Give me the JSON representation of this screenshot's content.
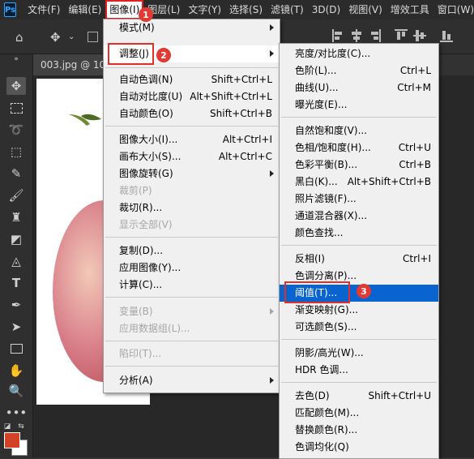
{
  "app": {
    "logo": "Ps"
  },
  "menubar": [
    "文件(F)",
    "编辑(E)",
    "图像(I)",
    "图层(L)",
    "文字(Y)",
    "选择(S)",
    "滤镜(T)",
    "3D(D)",
    "视图(V)",
    "增效工具",
    "窗口(W)"
  ],
  "options_bar": {
    "label": "控件"
  },
  "document": {
    "tab": "003.jpg @ 10"
  },
  "image_menu": [
    {
      "label": "模式(M)",
      "shortcut": "",
      "submenu": true,
      "disabled": false
    },
    {
      "label": "调整(J)",
      "shortcut": "",
      "submenu": true,
      "disabled": false
    },
    {
      "label": "自动色调(N)",
      "shortcut": "Shift+Ctrl+L",
      "submenu": false,
      "disabled": false
    },
    {
      "label": "自动对比度(U)",
      "shortcut": "Alt+Shift+Ctrl+L",
      "submenu": false,
      "disabled": false
    },
    {
      "label": "自动颜色(O)",
      "shortcut": "Shift+Ctrl+B",
      "submenu": false,
      "disabled": false
    },
    {
      "label": "图像大小(I)...",
      "shortcut": "Alt+Ctrl+I",
      "submenu": false,
      "disabled": false
    },
    {
      "label": "画布大小(S)...",
      "shortcut": "Alt+Ctrl+C",
      "submenu": false,
      "disabled": false
    },
    {
      "label": "图像旋转(G)",
      "shortcut": "",
      "submenu": true,
      "disabled": false
    },
    {
      "label": "裁剪(P)",
      "shortcut": "",
      "submenu": false,
      "disabled": true
    },
    {
      "label": "裁切(R)...",
      "shortcut": "",
      "submenu": false,
      "disabled": false
    },
    {
      "label": "显示全部(V)",
      "shortcut": "",
      "submenu": false,
      "disabled": true
    },
    {
      "label": "复制(D)...",
      "shortcut": "",
      "submenu": false,
      "disabled": false
    },
    {
      "label": "应用图像(Y)...",
      "shortcut": "",
      "submenu": false,
      "disabled": false
    },
    {
      "label": "计算(C)...",
      "shortcut": "",
      "submenu": false,
      "disabled": false
    },
    {
      "label": "变量(B)",
      "shortcut": "",
      "submenu": true,
      "disabled": true
    },
    {
      "label": "应用数据组(L)...",
      "shortcut": "",
      "submenu": false,
      "disabled": true
    },
    {
      "label": "陷印(T)...",
      "shortcut": "",
      "submenu": false,
      "disabled": true
    },
    {
      "label": "分析(A)",
      "shortcut": "",
      "submenu": true,
      "disabled": false
    }
  ],
  "adjust_menu": [
    {
      "label": "亮度/对比度(C)...",
      "shortcut": ""
    },
    {
      "label": "色阶(L)...",
      "shortcut": "Ctrl+L"
    },
    {
      "label": "曲线(U)...",
      "shortcut": "Ctrl+M"
    },
    {
      "label": "曝光度(E)...",
      "shortcut": ""
    },
    {
      "label": "自然饱和度(V)...",
      "shortcut": ""
    },
    {
      "label": "色相/饱和度(H)...",
      "shortcut": "Ctrl+U"
    },
    {
      "label": "色彩平衡(B)...",
      "shortcut": "Ctrl+B"
    },
    {
      "label": "黑白(K)...",
      "shortcut": "Alt+Shift+Ctrl+B"
    },
    {
      "label": "照片滤镜(F)...",
      "shortcut": ""
    },
    {
      "label": "通道混合器(X)...",
      "shortcut": ""
    },
    {
      "label": "颜色查找...",
      "shortcut": ""
    },
    {
      "label": "反相(I)",
      "shortcut": "Ctrl+I"
    },
    {
      "label": "色调分离(P)...",
      "shortcut": ""
    },
    {
      "label": "阈值(T)...",
      "shortcut": ""
    },
    {
      "label": "渐变映射(G)...",
      "shortcut": ""
    },
    {
      "label": "可选颜色(S)...",
      "shortcut": ""
    },
    {
      "label": "阴影/高光(W)...",
      "shortcut": ""
    },
    {
      "label": "HDR 色调...",
      "shortcut": ""
    },
    {
      "label": "去色(D)",
      "shortcut": "Shift+Ctrl+U"
    },
    {
      "label": "匹配颜色(M)...",
      "shortcut": ""
    },
    {
      "label": "替换颜色(R)...",
      "shortcut": ""
    },
    {
      "label": "色调均化(Q)",
      "shortcut": ""
    }
  ],
  "step_badges": [
    "1",
    "2",
    "3"
  ],
  "colors": {
    "foreground": "#d24227",
    "background": "#ffffff",
    "highlight": "#0a64d0",
    "annotation": "#e0302b"
  }
}
